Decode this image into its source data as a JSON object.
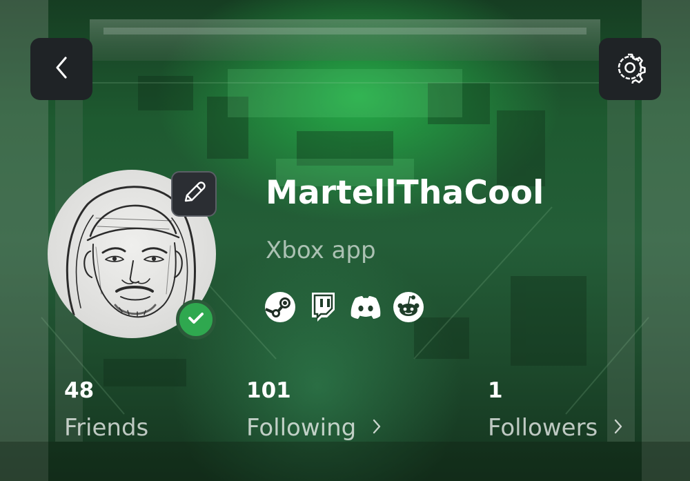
{
  "profile": {
    "username": "MartellThaCool",
    "platform": "Xbox app",
    "verified": true
  },
  "socials": [
    {
      "name": "steam"
    },
    {
      "name": "twitch"
    },
    {
      "name": "discord"
    },
    {
      "name": "reddit"
    }
  ],
  "stats": {
    "friends": {
      "count": "48",
      "label": "Friends"
    },
    "following": {
      "count": "101",
      "label": "Following"
    },
    "followers": {
      "count": "1",
      "label": "Followers"
    }
  },
  "colors": {
    "accent": "#2fa84f",
    "button_bg": "#1f2326"
  },
  "icons": {
    "back": "chevron-left-icon",
    "settings": "gear-icon",
    "edit": "pencil-icon",
    "verified": "checkmark-icon",
    "stat_arrow": "chevron-right-icon"
  }
}
